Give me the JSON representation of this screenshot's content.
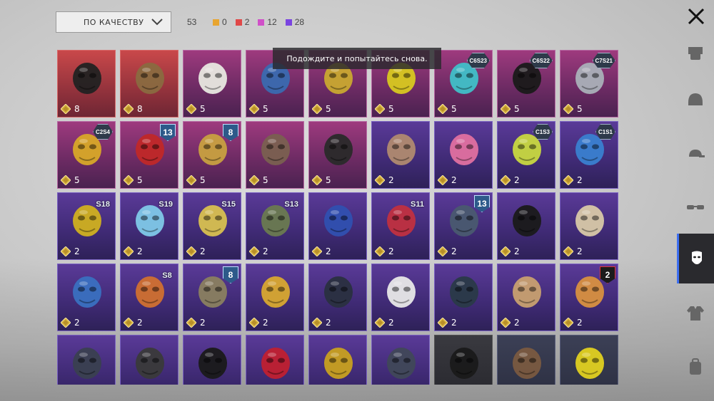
{
  "toolbar": {
    "sort_label": "ПО КАЧЕСТВУ",
    "total_count": "53",
    "legend": [
      {
        "color": "#e8a530",
        "count": "0"
      },
      {
        "color": "#e04848",
        "count": "2"
      },
      {
        "color": "#d050c8",
        "count": "12"
      },
      {
        "color": "#7a44e0",
        "count": "28"
      }
    ]
  },
  "toast": "Подождите и попытайтесь снова.",
  "sidebar": {
    "items": [
      {
        "icon": "outfit-icon"
      },
      {
        "icon": "helmet-icon"
      },
      {
        "icon": "cap-icon"
      },
      {
        "icon": "glasses-icon"
      },
      {
        "icon": "mask-icon",
        "active": true
      },
      {
        "icon": "jacket-icon"
      },
      {
        "icon": "backpack-icon"
      }
    ]
  },
  "items": [
    {
      "rarity": "red",
      "qty": "8",
      "badge": "",
      "icon": "combat-helmet-icon",
      "color": "#222"
    },
    {
      "rarity": "red",
      "qty": "8",
      "badge": "",
      "icon": "leopard-scarf-icon",
      "color": "#8a6a40"
    },
    {
      "rarity": "pink",
      "qty": "5",
      "badge": "",
      "icon": "cat-mask-icon",
      "color": "#e8e8e0"
    },
    {
      "rarity": "pink",
      "qty": "5",
      "badge": "",
      "icon": "respirator-icon",
      "color": "#3a6ab0"
    },
    {
      "rarity": "pink",
      "qty": "5",
      "badge": "",
      "icon": "gold-mask-icon",
      "color": "#c9a830"
    },
    {
      "rarity": "pink",
      "qty": "5",
      "badge": "",
      "icon": "yellow-visor-icon",
      "color": "#d8c820"
    },
    {
      "rarity": "pink",
      "qty": "5",
      "badge": "C6S23",
      "badgeType": "hex",
      "icon": "cyan-mask-icon",
      "color": "#40c0c8"
    },
    {
      "rarity": "pink",
      "qty": "5",
      "badge": "C6S22",
      "badgeType": "hex",
      "icon": "black-mask-icon",
      "color": "#1a1a1a"
    },
    {
      "rarity": "pink",
      "qty": "5",
      "badge": "C7S21",
      "badgeType": "hex",
      "icon": "silver-mask-icon",
      "color": "#aab0b8"
    },
    {
      "rarity": "pink",
      "qty": "5",
      "badge": "C2S4",
      "badgeType": "hex",
      "icon": "gold-helm-icon",
      "color": "#d8a828"
    },
    {
      "rarity": "pink",
      "qty": "5",
      "badge": "13",
      "badgeType": "shield",
      "icon": "red-crystal-icon",
      "color": "#c02828"
    },
    {
      "rarity": "pink",
      "qty": "5",
      "badge": "8",
      "badgeType": "shield",
      "icon": "gas-mask-gold-icon",
      "color": "#c8a040"
    },
    {
      "rarity": "pink",
      "qty": "5",
      "badge": "",
      "icon": "plague-mask-icon",
      "color": "#7a6050"
    },
    {
      "rarity": "pink",
      "qty": "5",
      "badge": "",
      "icon": "skull-scarf-icon",
      "color": "#2a2a2a"
    },
    {
      "rarity": "purple",
      "qty": "2",
      "badge": "",
      "icon": "mammoth-mask-icon",
      "color": "#b08a70"
    },
    {
      "rarity": "purple",
      "qty": "2",
      "badge": "",
      "icon": "pink-mask-icon",
      "color": "#e070a0"
    },
    {
      "rarity": "purple",
      "qty": "2",
      "badge": "C1S3",
      "badgeType": "hex",
      "icon": "green-bandana-icon",
      "color": "#c8d840"
    },
    {
      "rarity": "purple",
      "qty": "2",
      "badge": "C1S1",
      "badgeType": "hex",
      "icon": "blue-bandana-icon",
      "color": "#3a80d0"
    },
    {
      "rarity": "purple",
      "qty": "2",
      "badge": "S18",
      "badgeType": "wing",
      "icon": "neon-mask-icon",
      "color": "#d0b020"
    },
    {
      "rarity": "purple",
      "qty": "2",
      "badge": "S19",
      "badgeType": "wing",
      "icon": "visor-mask-icon",
      "color": "#80c8e8"
    },
    {
      "rarity": "purple",
      "qty": "2",
      "badge": "S15",
      "badgeType": "wing",
      "icon": "skull-gold-icon",
      "color": "#d8c050"
    },
    {
      "rarity": "purple",
      "qty": "2",
      "badge": "S13",
      "badgeType": "wing",
      "icon": "goggles-mask-icon",
      "color": "#6a7a50"
    },
    {
      "rarity": "purple",
      "qty": "2",
      "badge": "",
      "icon": "blue-beak-icon",
      "color": "#3050b0"
    },
    {
      "rarity": "purple",
      "qty": "2",
      "badge": "S11",
      "badgeType": "wing",
      "icon": "red-mask-icon",
      "color": "#c03040"
    },
    {
      "rarity": "purple",
      "qty": "2",
      "badge": "13",
      "badgeType": "shield",
      "icon": "tech-mask-icon",
      "color": "#4a5a70"
    },
    {
      "rarity": "purple",
      "qty": "2",
      "badge": "",
      "icon": "balaclava-icon",
      "color": "#1a1a1a"
    },
    {
      "rarity": "purple",
      "qty": "2",
      "badge": "",
      "icon": "tan-bandana-icon",
      "color": "#d8c8a8"
    },
    {
      "rarity": "purple",
      "qty": "2",
      "badge": "",
      "icon": "paisley-bandana-icon",
      "color": "#3a70c0"
    },
    {
      "rarity": "purple",
      "qty": "2",
      "badge": "S8",
      "badgeType": "wing",
      "icon": "flame-mask-icon",
      "color": "#d07030"
    },
    {
      "rarity": "purple",
      "qty": "2",
      "badge": "8",
      "badgeType": "shield",
      "icon": "camo-mask-icon",
      "color": "#8a8060"
    },
    {
      "rarity": "purple",
      "qty": "2",
      "badge": "",
      "icon": "yellow-cloth-mask-icon",
      "color": "#d8a830"
    },
    {
      "rarity": "purple",
      "qty": "2",
      "badge": "",
      "icon": "dark-helm-icon",
      "color": "#2a3040"
    },
    {
      "rarity": "purple",
      "qty": "2",
      "badge": "",
      "icon": "shark-mask-icon",
      "color": "#e8e8e8"
    },
    {
      "rarity": "purple",
      "qty": "2",
      "badge": "",
      "icon": "black-cloth-mask-icon",
      "color": "#2a3a48"
    },
    {
      "rarity": "purple",
      "qty": "2",
      "badge": "",
      "icon": "painted-mask-icon",
      "color": "#c8a070"
    },
    {
      "rarity": "purple",
      "qty": "2",
      "badge": "2",
      "badgeType": "red",
      "icon": "clown-mask-icon",
      "color": "#d89040"
    },
    {
      "rarity": "purple",
      "qty": "",
      "badge": "",
      "icon": "steel-skull-icon",
      "color": "#3a4050"
    },
    {
      "rarity": "purple",
      "qty": "",
      "badge": "",
      "icon": "dark-gas-mask-icon",
      "color": "#3a3a3a"
    },
    {
      "rarity": "purple",
      "qty": "",
      "badge": "",
      "icon": "black-scarf-icon",
      "color": "#1a1a1a"
    },
    {
      "rarity": "purple",
      "qty": "",
      "badge": "",
      "icon": "red-scarf-icon",
      "color": "#c02030"
    },
    {
      "rarity": "purple",
      "qty": "",
      "badge": "",
      "icon": "gold-cloth-mask-icon",
      "color": "#c8a020"
    },
    {
      "rarity": "purple",
      "qty": "",
      "badge": "",
      "icon": "grey-helm-icon",
      "color": "#404858"
    },
    {
      "rarity": "black",
      "qty": "",
      "badge": "",
      "icon": "aw-mask-icon",
      "color": "#1a1a1a"
    },
    {
      "rarity": "navy",
      "qty": "",
      "badge": "",
      "icon": "rusty-mask-icon",
      "color": "#7a5a40"
    },
    {
      "rarity": "navy",
      "qty": "",
      "badge": "",
      "icon": "yellow-net-scarf-icon",
      "color": "#e0d020"
    }
  ]
}
